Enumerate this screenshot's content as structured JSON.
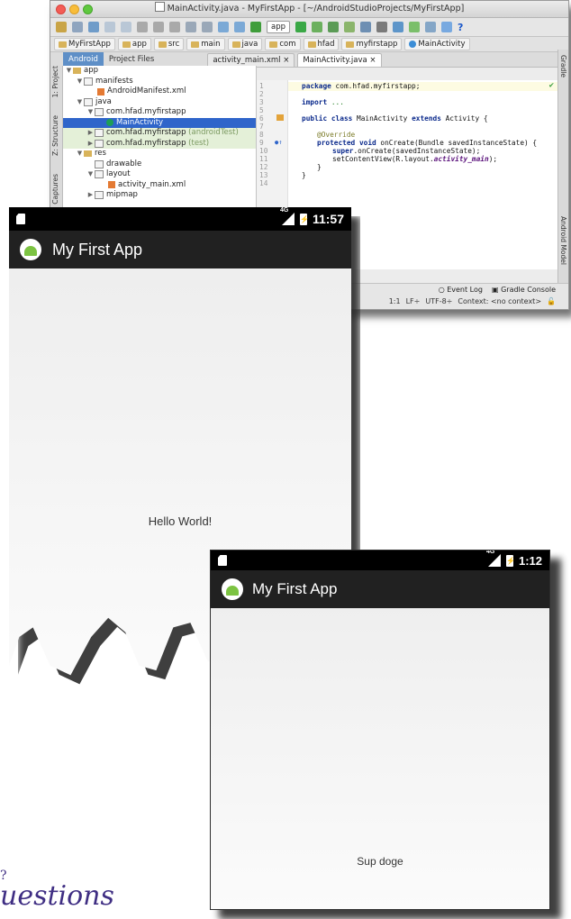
{
  "ide": {
    "window_title": "MainActivity.java - MyFirstApp - [~/AndroidStudioProjects/MyFirstApp]",
    "toolbar": {
      "run_config": "app",
      "help_icon": "?"
    },
    "breadcrumbs": [
      "MyFirstApp",
      "app",
      "src",
      "main",
      "java",
      "com",
      "hfad",
      "myfirstapp",
      "MainActivity"
    ],
    "project_tabs": {
      "view_android": "Android",
      "view_project_files": "Project Files"
    },
    "editor_tabs": [
      "activity_main.xml",
      "MainActivity.java"
    ],
    "side_tabs_left": [
      "1: Project",
      "Z: Structure",
      "Captures"
    ],
    "side_tabs_right": [
      "Gradle",
      "Android Model"
    ],
    "tree": [
      {
        "label": "app",
        "arrow": "▼"
      },
      {
        "label": "manifests",
        "arrow": "▼"
      },
      {
        "label": "AndroidManifest.xml",
        "arrow": ""
      },
      {
        "label": "java",
        "arrow": "▼"
      },
      {
        "label": "com.hfad.myfirstapp",
        "arrow": "▼"
      },
      {
        "label": "MainActivity",
        "arrow": ""
      },
      {
        "label": "com.hfad.myfirstapp",
        "suffix": "(androidTest)",
        "arrow": "▶"
      },
      {
        "label": "com.hfad.myfirstapp",
        "suffix": "(test)",
        "arrow": "▶"
      },
      {
        "label": "res",
        "arrow": "▼"
      },
      {
        "label": "drawable",
        "arrow": ""
      },
      {
        "label": "layout",
        "arrow": "▼"
      },
      {
        "label": "activity_main.xml",
        "arrow": ""
      },
      {
        "label": "mipmap",
        "arrow": "▶"
      }
    ],
    "line_numbers": [
      "1",
      "2",
      "3",
      "5",
      "6",
      "7",
      "8",
      "9",
      "10",
      "11",
      "12",
      "13",
      "14"
    ],
    "code": {
      "l1_kw": "package",
      "l1_rest": " com.hfad.myfirstapp;",
      "l3_kw": "import",
      "l3_rest": " ...",
      "l6_kw1": "public class",
      "l6_mid": " MainActivity ",
      "l6_kw2": "extends",
      "l6_rest": " Activity {",
      "l8": "@Override",
      "l9_kw": "protected void",
      "l9_rest": " onCreate(Bundle savedInstanceState) {",
      "l10_kw": "super",
      "l10_rest": ".onCreate(savedInstanceState);",
      "l11_pre": "setContentView(R.layout.",
      "l11_it": "activity_main",
      "l11_post": ");",
      "l12": "}",
      "l13": "}"
    },
    "status": {
      "event_log": "Event Log",
      "gradle_console": "Gradle Console",
      "position": "1:1",
      "line_sep": "LF÷",
      "encoding": "UTF-8÷",
      "context": "Context: <no context>"
    }
  },
  "phone1": {
    "network": "4G",
    "time": "11:57",
    "app_title": "My First App",
    "body_text": "Hello World!"
  },
  "phone2": {
    "network": "4G",
    "time": "1:12",
    "app_title": "My First App",
    "body_text": "Sup doge"
  },
  "footer": {
    "partial_text": "uestions",
    "mark": "?"
  }
}
